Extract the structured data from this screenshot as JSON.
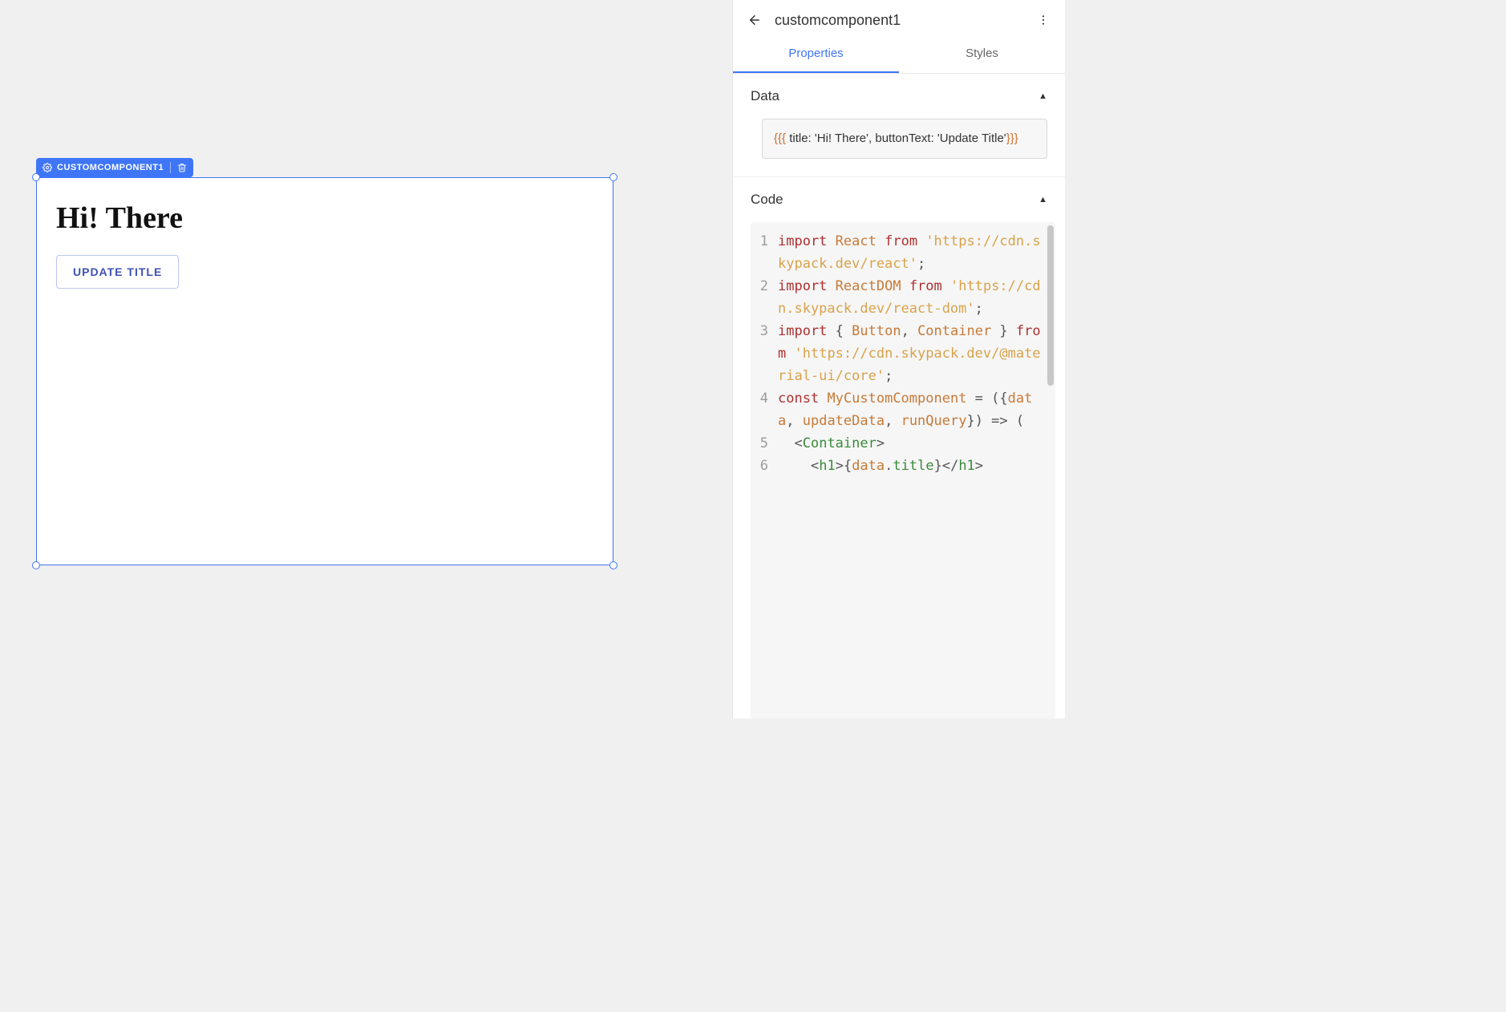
{
  "canvas": {
    "selection_label": "CUSTOMCOMPONENT1",
    "title": "Hi! There",
    "button_text": "UPDATE TITLE"
  },
  "panel": {
    "component_name": "customcomponent1",
    "tabs": {
      "properties": "Properties",
      "styles": "Styles"
    },
    "sections": {
      "data": {
        "heading": "Data",
        "open_braces": "{{{",
        "body": " title: 'Hi! There', buttonText: 'Update Title'",
        "close_braces": "}}}"
      },
      "code": {
        "heading": "Code",
        "lines": [
          {
            "n": "1",
            "kw1": "import",
            "id1": "React",
            "kw2": "from",
            "str1": "'https://cdn.skypack.dev/react'",
            "term": ";"
          },
          {
            "n": "2",
            "kw1": "import",
            "id1": "ReactDOM",
            "kw2": "from",
            "str1": "'https://cdn.skypack.dev/react-dom'",
            "term": ";"
          },
          {
            "n": "3",
            "kw1": "import",
            "open": "{ ",
            "id1": "Button",
            "comma": ", ",
            "id2": "Container",
            "close": " }",
            "kw2": " from",
            "str1": "'https://cdn.skypack.dev/@material-ui/core'",
            "term": ";"
          },
          {
            "n": "4",
            "kw1": "const",
            "id1": "MyCustomComponent",
            "eq": " = ",
            "open": "({",
            "arg1": "data",
            "c1": ", ",
            "arg2": "updateData",
            "c2": ", ",
            "arg3": "runQuery",
            "close": "}) => ("
          },
          {
            "n": "5",
            "indent": "  ",
            "t_open": "<",
            "t_name": "Container",
            "t_close": ">"
          },
          {
            "n": "6",
            "indent": "    ",
            "h_open": "<",
            "h_tag": "h1",
            "h_gt": ">",
            "cb_open": "{",
            "d1": "data",
            "dot": ".",
            "d2": "title",
            "cb_close": "}",
            "hc_open": "</",
            "hc_tag": "h1",
            "hc_gt": ">"
          }
        ]
      }
    }
  }
}
